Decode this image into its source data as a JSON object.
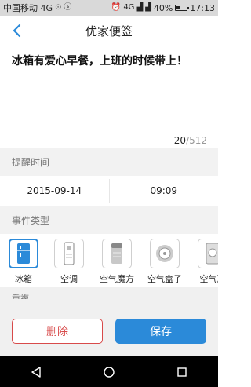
{
  "status_bar": {
    "carrier": "中国移动 4G",
    "network": "4G",
    "battery": "40%",
    "battery_level": 0.4,
    "time": "17:13"
  },
  "header": {
    "title": "优家便签",
    "back_icon": "chevron-left-icon"
  },
  "note": {
    "text": "冰箱有爱心早餐，上班的时候带上！",
    "count_current": "20",
    "count_max": "/512"
  },
  "reminder": {
    "label": "提醒时间",
    "date": "2015-09-14",
    "time": "09:09"
  },
  "event_type": {
    "label": "事件类型",
    "items": [
      {
        "label": "冰箱",
        "icon": "fridge-icon",
        "selected": true
      },
      {
        "label": "空调",
        "icon": "air-conditioner-icon",
        "selected": false
      },
      {
        "label": "空气魔方",
        "icon": "air-cube-icon",
        "selected": false
      },
      {
        "label": "空气盒子",
        "icon": "air-box-icon",
        "selected": false
      },
      {
        "label": "空气净",
        "icon": "air-purifier-icon",
        "selected": false
      }
    ]
  },
  "next_section": {
    "label": "重複"
  },
  "actions": {
    "delete_label": "删除",
    "save_label": "保存"
  },
  "colors": {
    "accent": "#2b8ad9",
    "danger": "#d84a4a"
  }
}
